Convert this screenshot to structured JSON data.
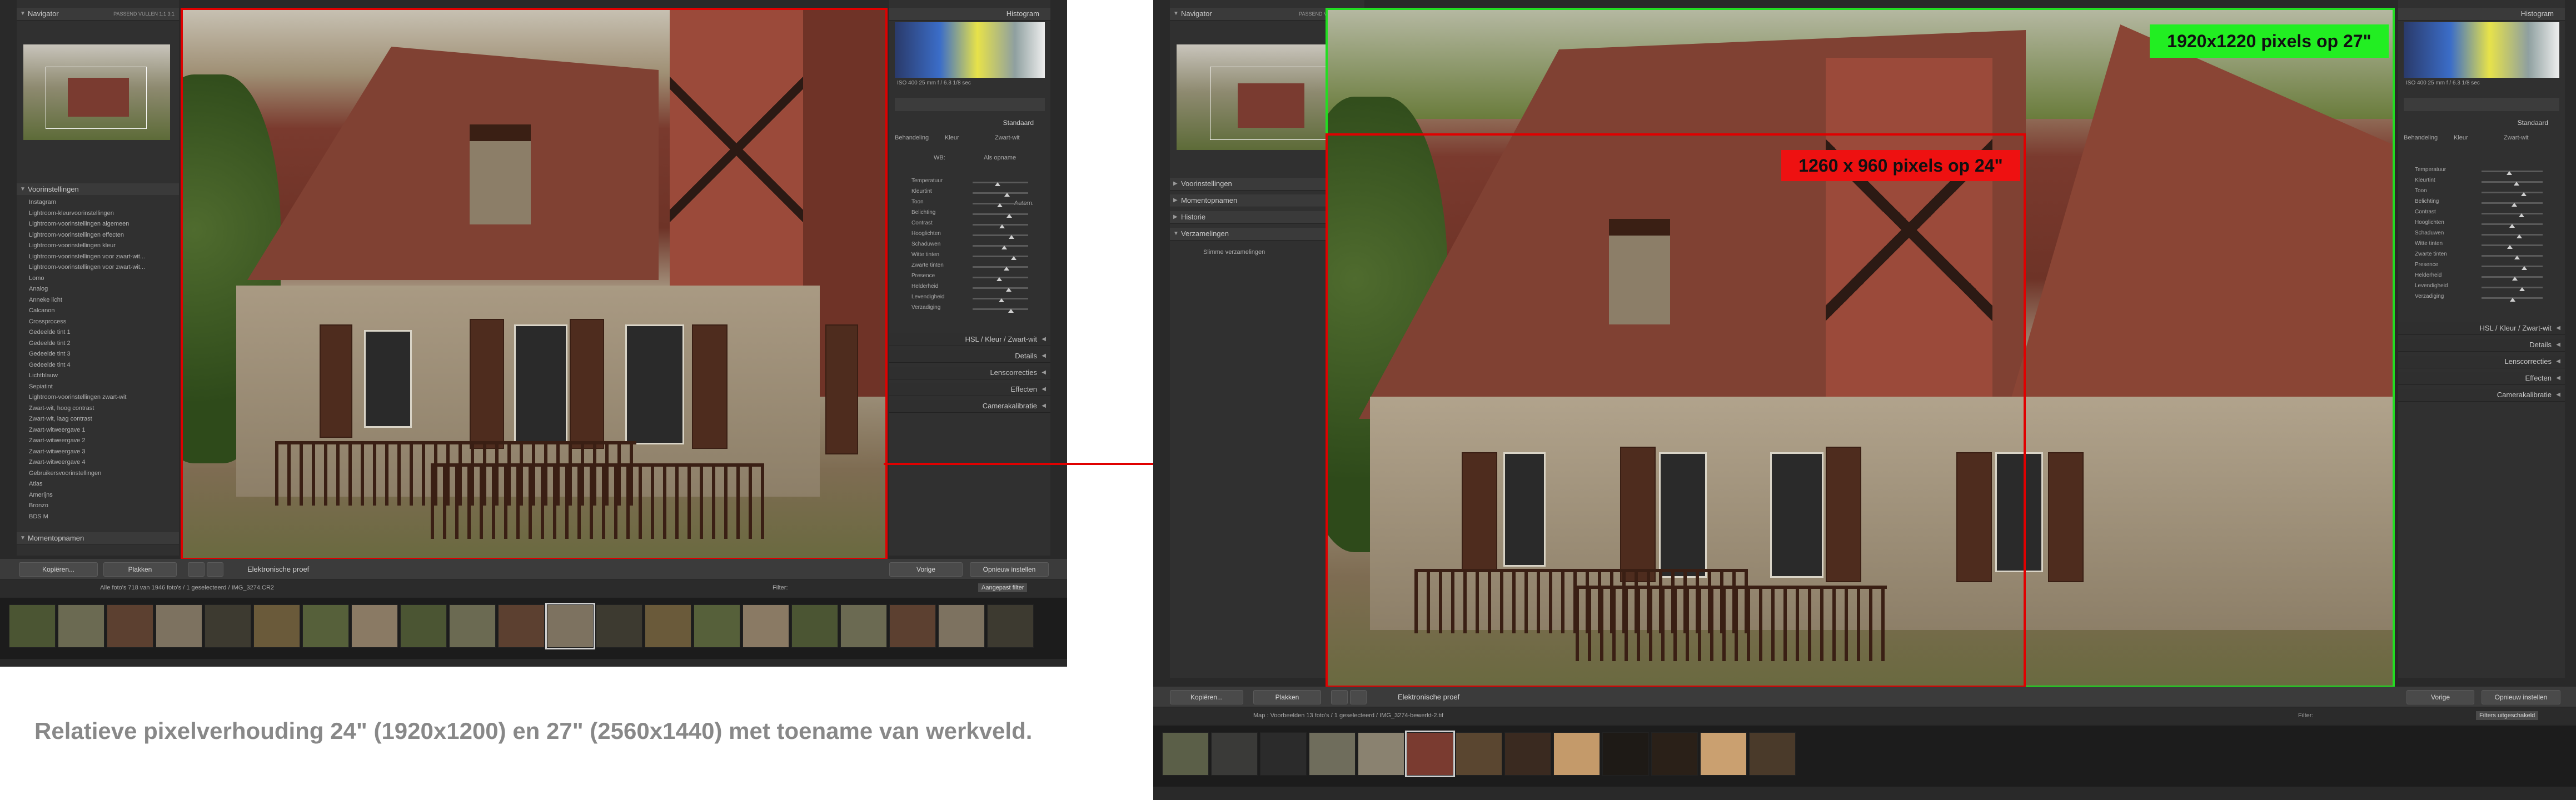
{
  "left": {
    "navigator_title": "Navigator",
    "navigator_zoom": "PASSEND  VULLEN  1:1  3:1",
    "presets_header": "Voorinstellingen",
    "presets_tree": [
      "Instagram",
      "Lightroom-kleurvoorinstellingen",
      "Lightroom-voorinstellingen algemeen",
      "Lightroom-voorinstellingen effecten",
      "Lightroom-voorinstellingen kleur",
      "Lightroom-voorinstellingen voor zwart-wit...",
      "Lightroom-voorinstellingen voor zwart-wit...",
      "Lomo",
      "Analog",
      "Anneke licht",
      "Calcanon",
      "Crossprocess",
      "Gedeelde tint 1",
      "Gedeelde tint 2",
      "Gedeelde tint 3",
      "Gedeelde tint 4",
      "Lichtblauw",
      "Sepiatint",
      "Lightroom-voorinstellingen zwart-wit",
      "Zwart-wit, hoog contrast",
      "Zwart-wit, laag contrast",
      "Zwart-witweergave 1",
      "Zwart-witweergave 2",
      "Zwart-witweergave 3",
      "Zwart-witweergave 4",
      "Gebruikersvoorinstellingen",
      "Atlas",
      "Amerijns",
      "Bronzo",
      "BDS M"
    ],
    "snapshots_header": "Momentopnamen",
    "copy_button": "Kopiëren...",
    "paste_button": "Plakken",
    "proof_label": "Elektronische proef",
    "prev_button": "Vorige",
    "reset_button": "Opnieuw instellen",
    "filmstrip_info": "Alle foto's    718 van 1946 foto's / 1 geselecteerd / IMG_3274.CR2",
    "filter_label": "Filter:",
    "filter_value": "Aangepast filter",
    "histogram_title": "Histogram",
    "histogram_meta": "ISO 400    25 mm    f / 6.3    1/8 sec",
    "standard_label": "Standaard",
    "basic_tabs": [
      "Behandeling",
      "Kleur",
      "Zwart-wit"
    ],
    "wb_label": "WB:",
    "wb_value": "Als opname",
    "basic_rows": [
      "Temperatuur",
      "Kleurtint",
      "Toon",
      "Belichting",
      "Contrast",
      "Hooglichten",
      "Schaduwen",
      "Witte tinten",
      "Zwarte tinten",
      "Presence",
      "Helderheid",
      "Levendigheid",
      "Verzadiging"
    ],
    "auto_label": "Autom.",
    "sections": [
      "HSL  /  Kleur  /  Zwart-wit",
      "Details",
      "Lenscorrecties",
      "Effecten",
      "Camerakalibratie"
    ]
  },
  "right": {
    "navigator_title": "Navigator",
    "navigator_zoom": "PASSEND  VULLEN  1:1  3:1",
    "panels": [
      "Voorinstellingen",
      "Momentopnamen",
      "Historie",
      "Verzamelingen"
    ],
    "collection_item": "Slimme verzamelingen",
    "copy_button": "Kopiëren...",
    "paste_button": "Plakken",
    "proof_label": "Elektronische proef",
    "prev_button": "Vorige",
    "reset_button": "Opnieuw instellen",
    "filmstrip_info": "Map : Voorbeelden     13 foto's / 1 geselecteerd / IMG_3274-bewerkt-2.tif",
    "filter_label": "Filter:",
    "filter_value": "Filters uitgeschakeld",
    "histogram_title": "Histogram",
    "histogram_meta": "ISO 400    25 mm    f / 6.3    1/8 sec",
    "standard_label": "Standaard",
    "basic_tabs": [
      "Behandeling",
      "Kleur",
      "Zwart-wit"
    ],
    "sections": [
      "HSL  /  Kleur  /  Zwart-wit",
      "Details",
      "Lenscorrecties",
      "Effecten",
      "Camerakalibratie"
    ],
    "label_27": "1920x1220 pixels op 27\"",
    "label_24": "1260 x 960 pixels op 24\""
  },
  "caption": "Relatieve pixelverhouding 24\" (1920x1200) en 27\" (2560x1440) met toename van werkveld.",
  "colors": {
    "red_frame": "#e00000",
    "green_frame": "#22dd22",
    "label_green_bg": "#22ee22",
    "label_red_bg": "#ee1111",
    "caption_text": "#888888"
  }
}
